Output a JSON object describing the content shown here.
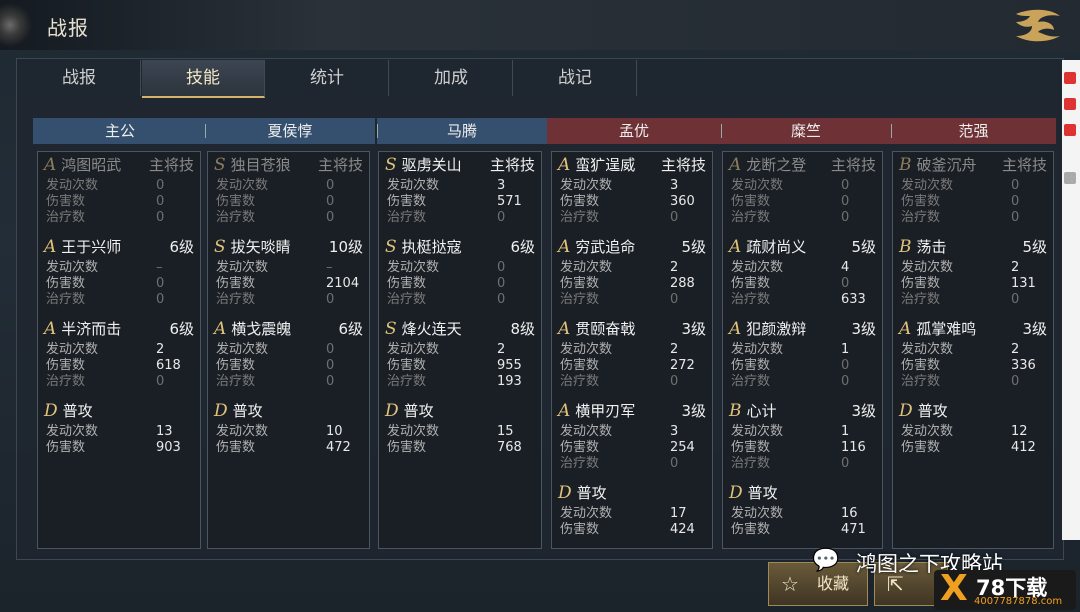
{
  "window": {
    "title": "战报"
  },
  "tabs": [
    "战报",
    "技能",
    "统计",
    "加成",
    "战记"
  ],
  "active_tab": "技能",
  "labels": {
    "trigger": "发动次数",
    "damage": "伤害数",
    "heal": "治疗数"
  },
  "generals": [
    {
      "name": "主公",
      "side": "blue",
      "skills": [
        {
          "grade": "A",
          "name": "鸿图昭武",
          "level": "主将技",
          "dim": true,
          "rows": [
            [
              "0",
              "z"
            ],
            [
              "0",
              "z"
            ],
            [
              "0",
              "z"
            ]
          ]
        },
        {
          "grade": "A",
          "name": "王于兴师",
          "level": "6级",
          "dim": false,
          "rows": [
            [
              "–",
              "z"
            ],
            [
              "0",
              "z"
            ],
            [
              "0",
              "z"
            ]
          ]
        },
        {
          "grade": "A",
          "name": "半济而击",
          "level": "6级",
          "dim": false,
          "rows": [
            [
              "2",
              ""
            ],
            [
              "618",
              ""
            ],
            [
              "0",
              "z"
            ]
          ]
        },
        {
          "grade": "D",
          "name": "普攻",
          "level": "",
          "dim": false,
          "rows": [
            [
              "13",
              ""
            ],
            [
              "903",
              ""
            ]
          ]
        }
      ]
    },
    {
      "name": "夏侯惇",
      "side": "blue",
      "skills": [
        {
          "grade": "S",
          "name": "独目苍狼",
          "level": "主将技",
          "dim": true,
          "rows": [
            [
              "0",
              "z"
            ],
            [
              "0",
              "z"
            ],
            [
              "0",
              "z"
            ]
          ]
        },
        {
          "grade": "S",
          "name": "拔矢啖睛",
          "level": "10级",
          "dim": false,
          "rows": [
            [
              "–",
              "z"
            ],
            [
              "2104",
              ""
            ],
            [
              "0",
              "z"
            ]
          ]
        },
        {
          "grade": "A",
          "name": "横戈震魄",
          "level": "6级",
          "dim": false,
          "rows": [
            [
              "0",
              "z"
            ],
            [
              "0",
              "z"
            ],
            [
              "0",
              "z"
            ]
          ]
        },
        {
          "grade": "D",
          "name": "普攻",
          "level": "",
          "dim": false,
          "rows": [
            [
              "10",
              ""
            ],
            [
              "472",
              ""
            ]
          ]
        }
      ]
    },
    {
      "name": "马腾",
      "side": "blue",
      "skills": [
        {
          "grade": "S",
          "name": "驱虏关山",
          "level": "主将技",
          "dim": false,
          "rows": [
            [
              "3",
              ""
            ],
            [
              "571",
              ""
            ],
            [
              "0",
              "z"
            ]
          ]
        },
        {
          "grade": "S",
          "name": "执梃挞寇",
          "level": "6级",
          "dim": false,
          "rows": [
            [
              "0",
              "z"
            ],
            [
              "0",
              "z"
            ],
            [
              "0",
              "z"
            ]
          ]
        },
        {
          "grade": "S",
          "name": "烽火连天",
          "level": "8级",
          "dim": false,
          "rows": [
            [
              "2",
              ""
            ],
            [
              "955",
              ""
            ],
            [
              "193",
              ""
            ]
          ]
        },
        {
          "grade": "D",
          "name": "普攻",
          "level": "",
          "dim": false,
          "rows": [
            [
              "15",
              ""
            ],
            [
              "768",
              ""
            ]
          ]
        }
      ]
    },
    {
      "name": "孟优",
      "side": "red",
      "skills": [
        {
          "grade": "A",
          "name": "蛮犷逞威",
          "level": "主将技",
          "dim": false,
          "rows": [
            [
              "3",
              ""
            ],
            [
              "360",
              ""
            ],
            [
              "0",
              "z"
            ]
          ]
        },
        {
          "grade": "A",
          "name": "穷武追命",
          "level": "5级",
          "dim": false,
          "rows": [
            [
              "2",
              ""
            ],
            [
              "288",
              ""
            ],
            [
              "0",
              "z"
            ]
          ]
        },
        {
          "grade": "A",
          "name": "贯颐奋戟",
          "level": "3级",
          "dim": false,
          "rows": [
            [
              "2",
              ""
            ],
            [
              "272",
              ""
            ],
            [
              "0",
              "z"
            ]
          ]
        },
        {
          "grade": "A",
          "name": "横甲刃军",
          "level": "3级",
          "dim": false,
          "rows": [
            [
              "3",
              ""
            ],
            [
              "254",
              ""
            ],
            [
              "0",
              "z"
            ]
          ]
        },
        {
          "grade": "D",
          "name": "普攻",
          "level": "",
          "dim": false,
          "rows": [
            [
              "17",
              ""
            ],
            [
              "424",
              ""
            ]
          ]
        }
      ]
    },
    {
      "name": "糜竺",
      "side": "red",
      "skills": [
        {
          "grade": "A",
          "name": "龙断之登",
          "level": "主将技",
          "dim": true,
          "rows": [
            [
              "0",
              "z"
            ],
            [
              "0",
              "z"
            ],
            [
              "0",
              "z"
            ]
          ]
        },
        {
          "grade": "A",
          "name": "疏财尚义",
          "level": "5级",
          "dim": false,
          "rows": [
            [
              "4",
              ""
            ],
            [
              "0",
              "z"
            ],
            [
              "633",
              ""
            ]
          ]
        },
        {
          "grade": "A",
          "name": "犯颜激辩",
          "level": "3级",
          "dim": false,
          "rows": [
            [
              "1",
              ""
            ],
            [
              "0",
              "z"
            ],
            [
              "0",
              "z"
            ]
          ]
        },
        {
          "grade": "B",
          "name": "心计",
          "level": "3级",
          "dim": false,
          "rows": [
            [
              "1",
              ""
            ],
            [
              "116",
              ""
            ],
            [
              "0",
              "z"
            ]
          ]
        },
        {
          "grade": "D",
          "name": "普攻",
          "level": "",
          "dim": false,
          "rows": [
            [
              "16",
              ""
            ],
            [
              "471",
              ""
            ]
          ]
        }
      ]
    },
    {
      "name": "范强",
      "side": "red",
      "skills": [
        {
          "grade": "B",
          "name": "破釜沉舟",
          "level": "主将技",
          "dim": true,
          "rows": [
            [
              "0",
              "z"
            ],
            [
              "0",
              "z"
            ],
            [
              "0",
              "z"
            ]
          ]
        },
        {
          "grade": "B",
          "name": "荡击",
          "level": "5级",
          "dim": false,
          "rows": [
            [
              "2",
              ""
            ],
            [
              "131",
              ""
            ],
            [
              "0",
              "z"
            ]
          ]
        },
        {
          "grade": "A",
          "name": "孤掌难鸣",
          "level": "3级",
          "dim": false,
          "rows": [
            [
              "2",
              ""
            ],
            [
              "336",
              ""
            ],
            [
              "0",
              "z"
            ]
          ]
        },
        {
          "grade": "D",
          "name": "普攻",
          "level": "",
          "dim": false,
          "rows": [
            [
              "12",
              ""
            ],
            [
              "412",
              ""
            ]
          ]
        }
      ]
    }
  ],
  "buttons": {
    "favorite": "收藏"
  },
  "watermark": {
    "text": "鸿图之下攻略站",
    "badge": "78下载",
    "badge_sub": "4007787878.com"
  },
  "colors": {
    "blue_header": "#35506e",
    "red_header": "#6e3236",
    "gold": "#e0c27a"
  }
}
